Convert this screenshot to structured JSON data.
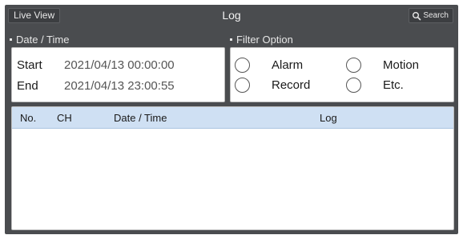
{
  "header": {
    "live_view_label": "Live View",
    "title": "Log",
    "search_label": "Search",
    "search_icon": "search-icon"
  },
  "date_time": {
    "section_label": "Date / Time",
    "start_label": "Start",
    "start_value": "2021/04/13 00:00:00",
    "end_label": "End",
    "end_value": "2021/04/13 23:00:55"
  },
  "filter": {
    "section_label": "Filter Option",
    "options": [
      {
        "label": "Alarm",
        "selected": false
      },
      {
        "label": "Motion",
        "selected": false
      },
      {
        "label": "Record",
        "selected": false
      },
      {
        "label": "Etc.",
        "selected": false
      }
    ]
  },
  "log_table": {
    "columns": [
      "No.",
      "CH",
      "Date / Time",
      "Log"
    ],
    "rows": []
  },
  "colors": {
    "frame": "#4a4c4f",
    "table_header": "#cfe0f3"
  }
}
